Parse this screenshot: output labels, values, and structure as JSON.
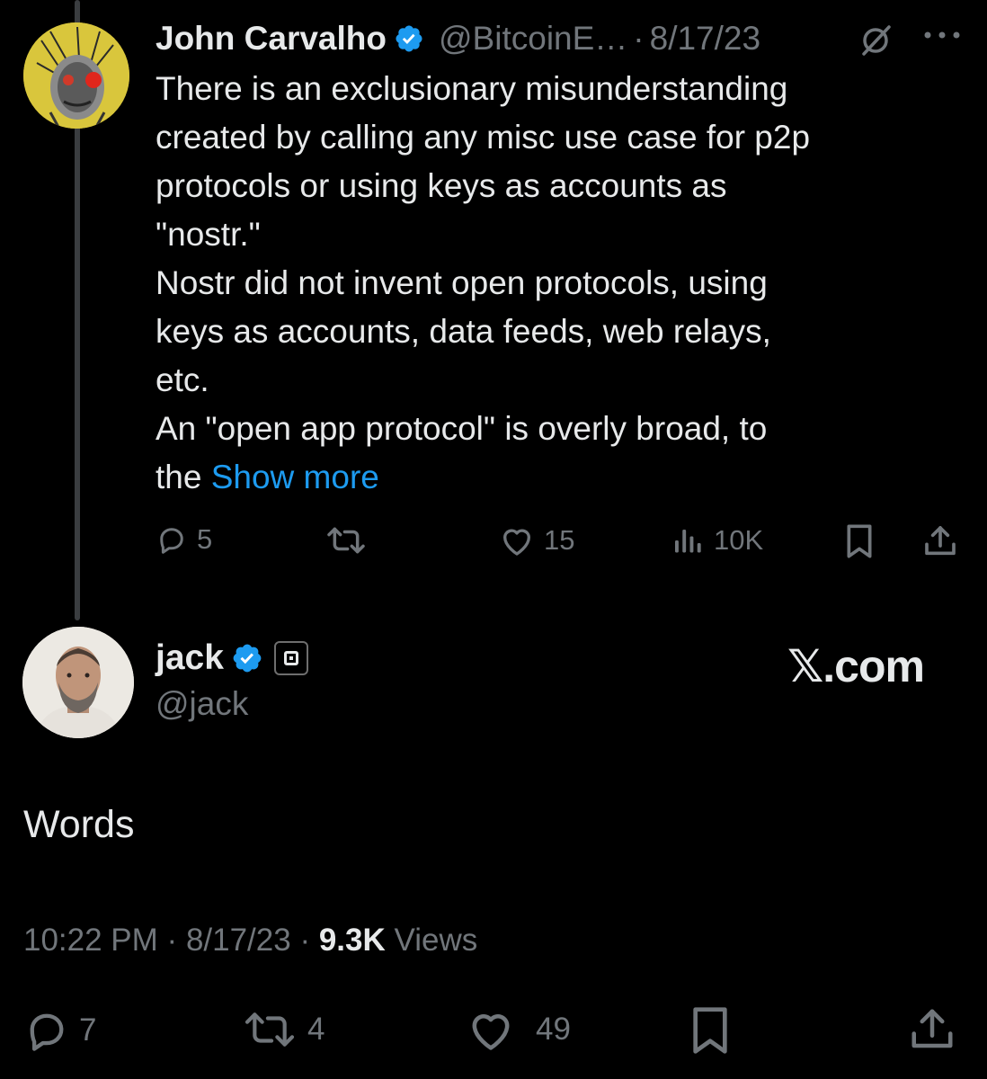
{
  "tweet1": {
    "author_name": "John Carvalho",
    "handle": "@BitcoinE…",
    "separator": "·",
    "date": "8/17/23",
    "body_lines": [
      "There is an exclusionary misunderstanding",
      "created by calling any misc use case for p2p",
      "protocols or using keys as accounts as",
      "\"nostr.\"",
      "Nostr did not invent open protocols, using",
      "keys as accounts, data feeds, web relays,",
      "etc.",
      "An \"open app protocol\" is overly broad, to"
    ],
    "last_line_prefix": "the ",
    "show_more": "Show more",
    "actions": {
      "replies": "5",
      "reposts": "",
      "likes": "15",
      "views": "10K"
    }
  },
  "tweet2": {
    "author_name": "jack",
    "handle": "@jack",
    "watermark": "𝕏.com",
    "text": "Words",
    "meta": {
      "time": "10:22 PM",
      "sep1": "·",
      "date": "8/17/23",
      "sep2": "·",
      "views_count": "9.3K",
      "views_label": "Views"
    },
    "actions": {
      "replies": "7",
      "reposts": "4",
      "likes": "49"
    }
  },
  "colors": {
    "background": "#000000",
    "text": "#e7e9ea",
    "muted": "#71767b",
    "link": "#1d9bf0",
    "verified": "#1d9bf0"
  },
  "icons": [
    "verified-badge-icon",
    "grok-icon",
    "more-icon",
    "reply-icon",
    "repost-icon",
    "like-icon",
    "views-icon",
    "bookmark-icon",
    "share-icon",
    "affiliate-badge-icon"
  ]
}
